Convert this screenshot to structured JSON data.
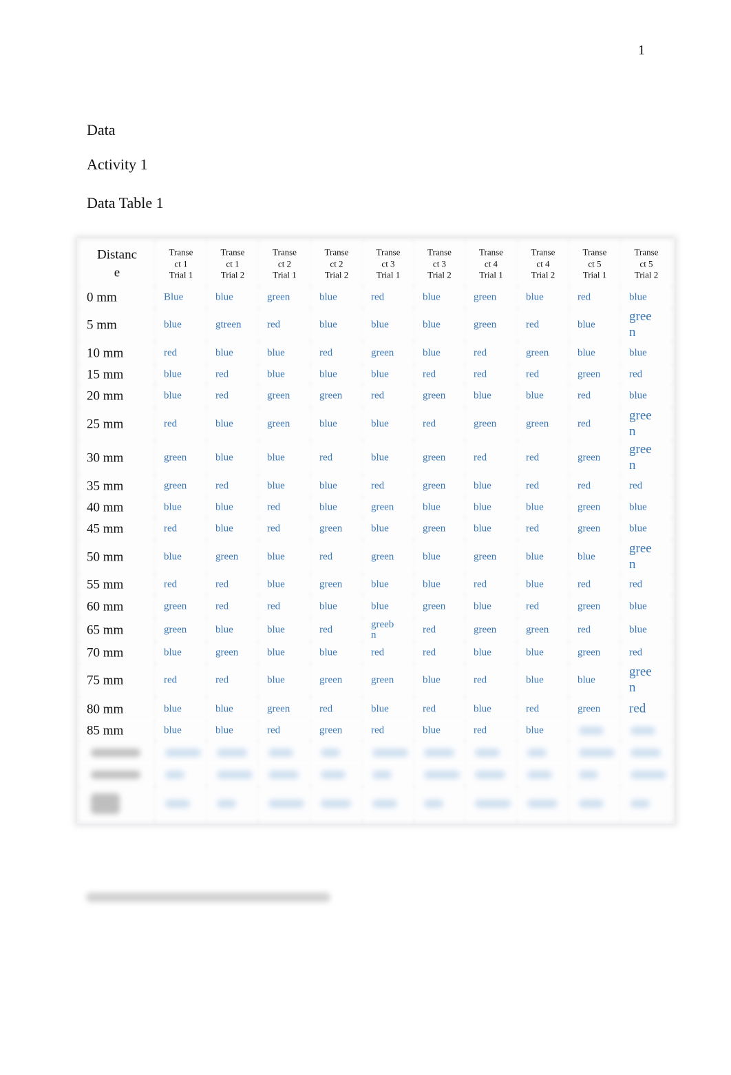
{
  "page_number": "1",
  "headings": {
    "section": "Data",
    "activity": "Activity 1",
    "table_title": "Data Table 1"
  },
  "table": {
    "distance_header": "Distanc\ne",
    "column_headers": [
      "Transe\nct 1\nTrial 1",
      "Transe\nct 1\nTrial 2",
      "Transe\nct 2\nTrial 1",
      "Transe\nct 2\nTrial 2",
      "Transe\nct 3\nTrial 1",
      "Transe\nct 3\nTrial 2",
      "Transe\nct 4\nTrial 1",
      "Transe\nct 4\nTrial 2",
      "Transe\nct 5\nTrial 1",
      "Transe\nct 5\nTrial 2"
    ],
    "rows": [
      {
        "distance": "0 mm",
        "values": [
          "Blue",
          "blue",
          "green",
          "blue",
          "red",
          "blue",
          "green",
          "blue",
          "red",
          "blue"
        ]
      },
      {
        "distance": "5 mm",
        "values": [
          "blue",
          "gtreen",
          "red",
          "blue",
          "blue",
          "blue",
          "green",
          "red",
          "blue",
          "gree\nn"
        ]
      },
      {
        "distance": "10 mm",
        "values": [
          "red",
          "blue",
          "blue",
          "red",
          "green",
          "blue",
          "red",
          "green",
          "blue",
          "blue"
        ]
      },
      {
        "distance": "15 mm",
        "values": [
          "blue",
          "red",
          "blue",
          "blue",
          "blue",
          "red",
          "red",
          "red",
          "green",
          "red"
        ]
      },
      {
        "distance": "20 mm",
        "values": [
          "blue",
          "red",
          "green",
          "green",
          "red",
          "green",
          "blue",
          "blue",
          "red",
          "blue"
        ]
      },
      {
        "distance": "25 mm",
        "values": [
          "red",
          "blue",
          "green",
          "blue",
          "blue",
          "red",
          "green",
          "green",
          "red",
          "gree\nn"
        ]
      },
      {
        "distance": "30 mm",
        "values": [
          "green",
          "blue",
          "blue",
          "red",
          "blue",
          "green",
          "red",
          "red",
          "green",
          "gree\nn"
        ]
      },
      {
        "distance": "35 mm",
        "values": [
          "green",
          "red",
          "blue",
          "blue",
          "red",
          "green",
          "blue",
          "red",
          "red",
          "red"
        ]
      },
      {
        "distance": "40 mm",
        "values": [
          "blue",
          "blue",
          "red",
          "blue",
          "green",
          "blue",
          "blue",
          "blue",
          "green",
          "blue"
        ]
      },
      {
        "distance": "45 mm",
        "values": [
          "red",
          "blue",
          "red",
          "green",
          "blue",
          "green",
          "blue",
          "red",
          "green",
          "blue"
        ]
      },
      {
        "distance": "50 mm",
        "values": [
          "blue",
          "green",
          "blue",
          "red",
          "green",
          "blue",
          "green",
          "blue",
          "blue",
          "gree\nn"
        ]
      },
      {
        "distance": "55 mm",
        "values": [
          "red",
          "red",
          "blue",
          "green",
          "blue",
          "blue",
          "red",
          "blue",
          "red",
          "red"
        ]
      },
      {
        "distance": "60 mm",
        "values": [
          "green",
          "red",
          "red",
          "blue",
          "blue",
          "green",
          "blue",
          "red",
          "green",
          "blue"
        ]
      },
      {
        "distance": "65 mm",
        "values": [
          "green",
          "blue",
          "blue",
          "red",
          "greeb\nn",
          "red",
          "green",
          "green",
          "red",
          "blue"
        ]
      },
      {
        "distance": "70 mm",
        "values": [
          "blue",
          "green",
          "blue",
          "blue",
          "red",
          "red",
          "blue",
          "blue",
          "green",
          "red"
        ]
      },
      {
        "distance": "75 mm",
        "values": [
          "red",
          "red",
          "blue",
          "green",
          "green",
          "blue",
          "red",
          "blue",
          "blue",
          "gree\nn"
        ]
      },
      {
        "distance": "80 mm",
        "values": [
          "blue",
          "blue",
          "green",
          "red",
          "blue",
          "red",
          "blue",
          "red",
          "green",
          "red"
        ]
      },
      {
        "distance": "85 mm",
        "values": [
          "blue",
          "blue",
          "red",
          "green",
          "red",
          "blue",
          "red",
          "blue",
          "",
          ""
        ]
      }
    ],
    "blurred_rows_count": 3
  },
  "colors": {
    "cell_text": "#3b78b6",
    "label_text": "#111111",
    "grid_shade": "#f3f3f4"
  }
}
